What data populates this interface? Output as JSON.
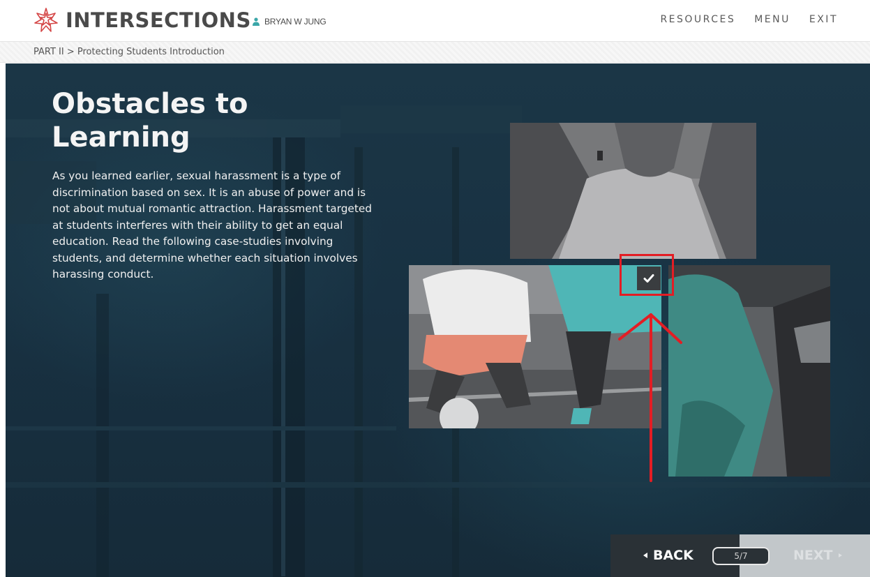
{
  "header": {
    "brand": "INTERSECTIONS",
    "user_name": "BRYAN W JUNG",
    "nav": [
      "RESOURCES",
      "MENU",
      "EXIT"
    ]
  },
  "breadcrumb": "PART II > Protecting Students Introduction",
  "content": {
    "title": "Obstacles to Learning",
    "body": "As you learned earlier, sexual harassment is a type of discrimination based on sex. It is an abuse of power and is not about mutual romantic attraction. Harassment targeted at students interferes with their ability to get an equal education. Read the following case-studies involving students, and determine whether each situation involves harassing conduct."
  },
  "navigation": {
    "back_label": "BACK",
    "page_indicator": "5/7",
    "next_label": "NEXT"
  },
  "icons": {
    "logo": "intersections-star-logo",
    "user": "user-icon",
    "check": "checkmark-icon"
  },
  "colors": {
    "brand_red": "#d44545",
    "accent_teal": "#3aa6a8",
    "annotation_red": "#e31d24",
    "stage_bg": "#183142"
  }
}
